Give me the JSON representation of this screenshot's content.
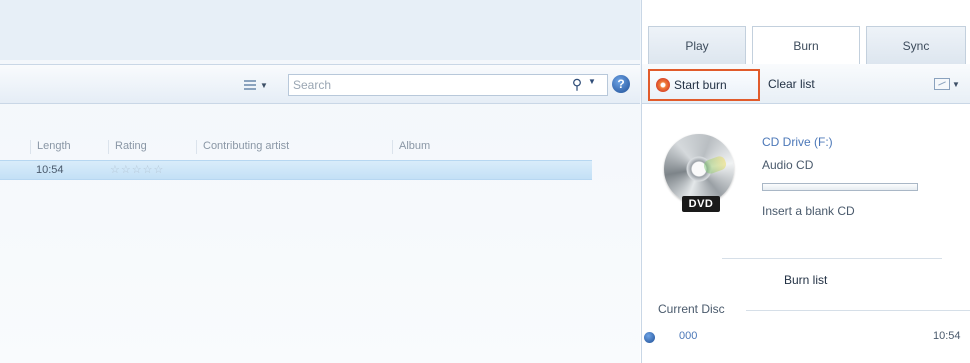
{
  "library": {
    "search": {
      "placeholder": "Search"
    },
    "columns": [
      "Length",
      "Rating",
      "Contributing artist",
      "Album"
    ],
    "selected_row": {
      "length": "10:54",
      "rating": "☆☆☆☆☆"
    }
  },
  "tabs": [
    {
      "label": "Play",
      "active": false
    },
    {
      "label": "Burn",
      "active": true
    },
    {
      "label": "Sync",
      "active": false
    }
  ],
  "burn_toolbar": {
    "start_burn": "Start burn",
    "clear_list": "Clear list"
  },
  "drive": {
    "name": "CD Drive (F:)",
    "type": "Audio CD",
    "badge": "DVD",
    "message": "Insert a blank CD",
    "progress": 0
  },
  "burn_list": {
    "label": "Burn list"
  },
  "current_disc": {
    "label": "Current Disc",
    "track_number": "000",
    "length": "10:54"
  },
  "colors": {
    "accent": "#e15b2b",
    "link": "#4c78b8",
    "selection": "#c3e0f6"
  }
}
